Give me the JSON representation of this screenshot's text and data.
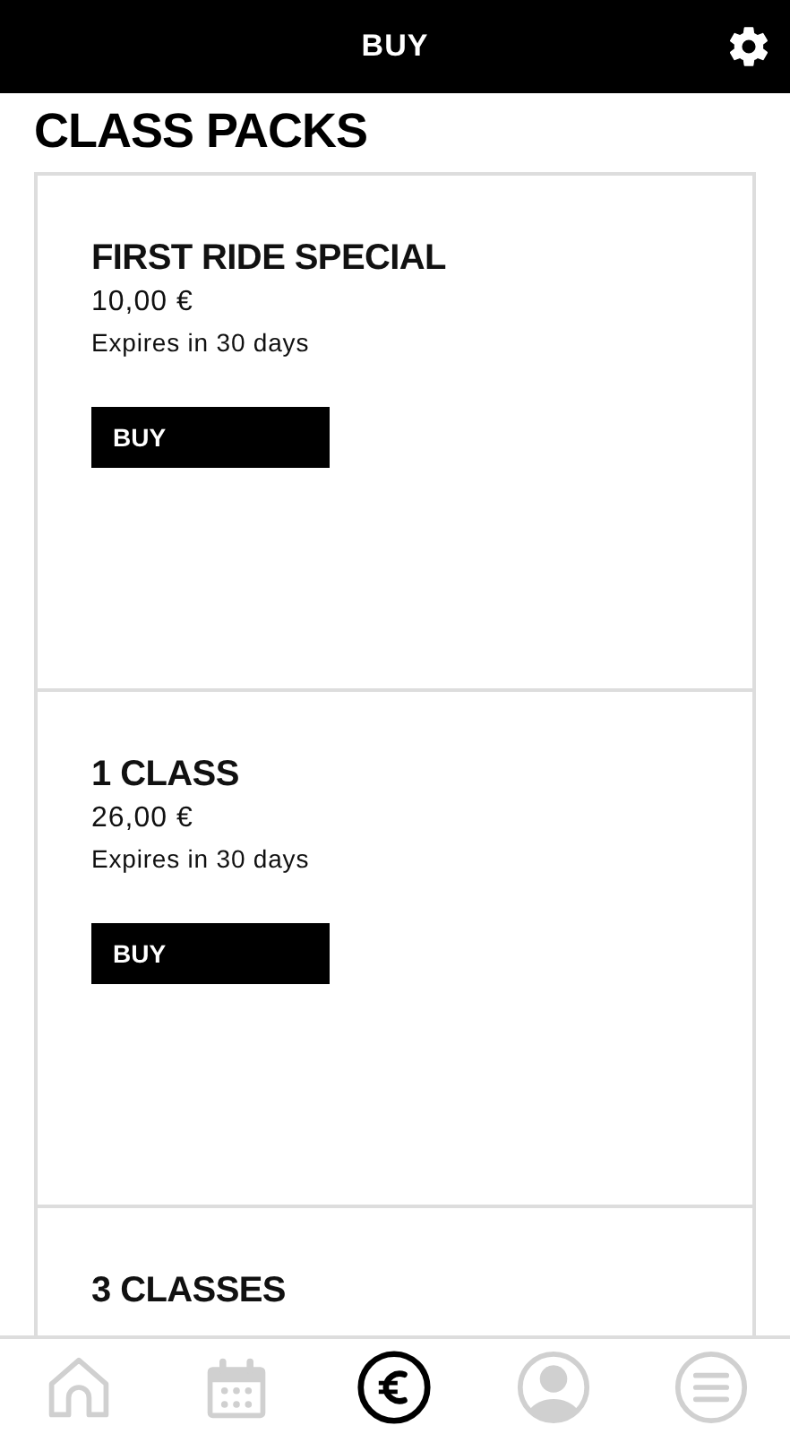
{
  "header": {
    "title": "BUY"
  },
  "section_title": "CLASS PACKS",
  "packs": [
    {
      "name": "FIRST RIDE SPECIAL",
      "price": "10,00 €",
      "expiry": "Expires in 30 days",
      "button": "BUY"
    },
    {
      "name": "1 CLASS",
      "price": "26,00 €",
      "expiry": "Expires in 30 days",
      "button": "BUY"
    },
    {
      "name": "3 CLASSES"
    }
  ],
  "nav": [
    {
      "kind": "home",
      "selected": false
    },
    {
      "kind": "calendar",
      "selected": false
    },
    {
      "kind": "euro",
      "selected": true
    },
    {
      "kind": "profile",
      "selected": false
    },
    {
      "kind": "menu",
      "selected": false
    }
  ]
}
